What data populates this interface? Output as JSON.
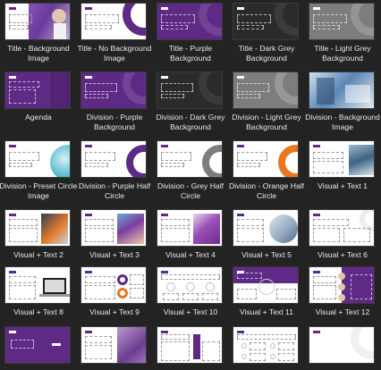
{
  "colors": {
    "background": "#232323",
    "purple": "#5f2a86",
    "dark_grey": "#2b2b2b",
    "light_grey": "#7d7d7d",
    "orange": "#e87722",
    "label": "#e8e8e8"
  },
  "layouts": [
    {
      "label": "Title - Background Image",
      "variant": "title-image"
    },
    {
      "label": "Title - No Background Image",
      "variant": "title-white"
    },
    {
      "label": "Title - Purple Background",
      "variant": "title-purple"
    },
    {
      "label": "Title - Dark Grey Background",
      "variant": "title-dark"
    },
    {
      "label": "Title - Light Grey Background",
      "variant": "title-light"
    },
    {
      "label": "Agenda",
      "variant": "agenda"
    },
    {
      "label": "Division - Purple Background",
      "variant": "division-purple"
    },
    {
      "label": "Division - Dark Grey Background",
      "variant": "division-dark"
    },
    {
      "label": "Division - Light Grey Background",
      "variant": "division-light"
    },
    {
      "label": "Division - Background Image",
      "variant": "division-image"
    },
    {
      "label": "Division - Preset Circle Image",
      "variant": "division-circle"
    },
    {
      "label": "Division - Purple Half Circle",
      "variant": "half-purple"
    },
    {
      "label": "Division - Grey Half Circle",
      "variant": "half-grey"
    },
    {
      "label": "Division - Orange Half Circle",
      "variant": "half-orange"
    },
    {
      "label": "Visual + Text 1",
      "variant": "vt1"
    },
    {
      "label": "Visual + Text 2",
      "variant": "vt2"
    },
    {
      "label": "Visual + Text 3",
      "variant": "vt3"
    },
    {
      "label": "Visual + Text 4",
      "variant": "vt4"
    },
    {
      "label": "Visual + Text 5",
      "variant": "vt5"
    },
    {
      "label": "Visual + Text 6",
      "variant": "vt6"
    },
    {
      "label": "Visual + Text 8",
      "variant": "vt8"
    },
    {
      "label": "Visual + Text 9",
      "variant": "vt9"
    },
    {
      "label": "Visual + Text 10",
      "variant": "vt10"
    },
    {
      "label": "Visual + Text 11",
      "variant": "vt11"
    },
    {
      "label": "Visual + Text 12",
      "variant": "vt12"
    },
    {
      "label": "",
      "variant": "r6-purple"
    },
    {
      "label": "",
      "variant": "r6-photo"
    },
    {
      "label": "",
      "variant": "r6-table"
    },
    {
      "label": "",
      "variant": "r6-grid"
    },
    {
      "label": "",
      "variant": "r6-blank"
    }
  ]
}
